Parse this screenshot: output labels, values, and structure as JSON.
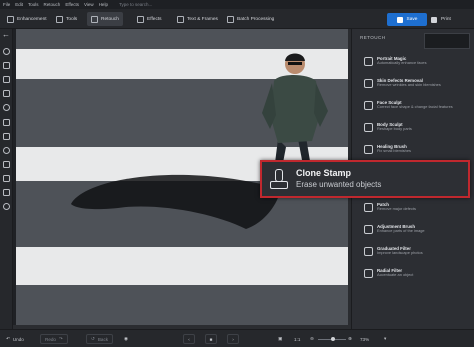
{
  "menu": [
    "File",
    "Edit",
    "Tools",
    "Retouch",
    "Effects",
    "View",
    "Help"
  ],
  "menu_search": "Type to search...",
  "tabs": [
    {
      "label": "Enhancement",
      "icon": "sliders-icon"
    },
    {
      "label": "Tools",
      "icon": "crop-icon"
    },
    {
      "label": "Retouch",
      "icon": "brush-icon"
    },
    {
      "label": "Effects",
      "icon": "sparkle-icon"
    },
    {
      "label": "Text & Frames",
      "icon": "text-icon"
    },
    {
      "label": "Batch Processing",
      "icon": "layers-icon"
    }
  ],
  "active_tab": "Retouch",
  "actions": {
    "save": "Save",
    "print": "Print"
  },
  "panel": {
    "title": "RETOUCH",
    "tools": [
      {
        "name": "Portrait Magic",
        "desc": "Automatically enhance faces",
        "icon": "face-icon"
      },
      {
        "name": "Skin Defects Removal",
        "desc": "Remove wrinkles and skin blemishes",
        "icon": "bandage-icon"
      },
      {
        "name": "Face Sculpt",
        "desc": "Correct face shape & change facial features",
        "icon": "face-sculpt-icon"
      },
      {
        "name": "Body Sculpt",
        "desc": "Reshape body parts",
        "icon": "body-icon"
      },
      {
        "name": "Healing Brush",
        "desc": "Fix small blemishes",
        "icon": "healing-brush-icon"
      },
      {
        "name": "Patch",
        "desc": "Remove major defects",
        "icon": "patch-icon"
      },
      {
        "name": "Adjustment Brush",
        "desc": "Enhance parts of the image",
        "icon": "adjustment-brush-icon"
      },
      {
        "name": "Graduated Filter",
        "desc": "Improve landscape photos",
        "icon": "graduated-filter-icon"
      },
      {
        "name": "Radial Filter",
        "desc": "Accentuate an object",
        "icon": "radial-filter-icon"
      }
    ]
  },
  "callout": {
    "name": "Clone Stamp",
    "desc": "Erase unwanted objects",
    "icon": "clone-stamp-icon",
    "border_color": "#c0282e"
  },
  "bottom": {
    "undo": "Undo",
    "redo": "Redo",
    "back": "Back",
    "zoom_ratio": "1:1",
    "zoom_percent": "73%"
  },
  "colors": {
    "accent": "#1e6fd0",
    "highlight": "#c0282e"
  }
}
